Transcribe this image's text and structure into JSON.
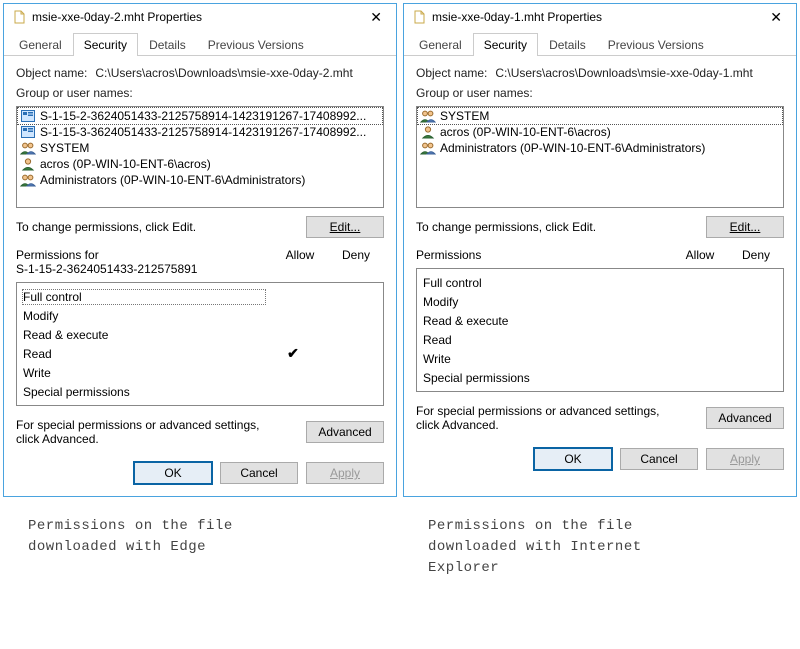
{
  "dialogs": [
    {
      "title": "msie-xxe-0day-2.mht Properties",
      "tabs": [
        "General",
        "Security",
        "Details",
        "Previous Versions"
      ],
      "active_tab": "Security",
      "object_label": "Object name:",
      "object_path": "C:\\Users\\acros\\Downloads\\msie-xxe-0day-2.mht",
      "group_label": "Group or user names:",
      "principals": [
        {
          "icon": "pkg",
          "text": "S-1-15-2-3624051433-2125758914-1423191267-17408992...",
          "selected": true
        },
        {
          "icon": "pkg",
          "text": "S-1-15-3-3624051433-2125758914-1423191267-17408992..."
        },
        {
          "icon": "group",
          "text": "SYSTEM"
        },
        {
          "icon": "user",
          "text": "acros (0P-WIN-10-ENT-6\\acros)"
        },
        {
          "icon": "group",
          "text": "Administrators (0P-WIN-10-ENT-6\\Administrators)"
        }
      ],
      "edit_text": "To change permissions, click Edit.",
      "edit_btn": "Edit...",
      "perm_for_label": "Permissions for\nS-1-15-2-3624051433-212575891",
      "col_allow": "Allow",
      "col_deny": "Deny",
      "permissions": [
        {
          "name": "Full control",
          "allow": "",
          "deny": "",
          "selected": true
        },
        {
          "name": "Modify",
          "allow": "",
          "deny": ""
        },
        {
          "name": "Read & execute",
          "allow": "",
          "deny": ""
        },
        {
          "name": "Read",
          "allow": "✔",
          "deny": ""
        },
        {
          "name": "Write",
          "allow": "",
          "deny": ""
        },
        {
          "name": "Special permissions",
          "allow": "",
          "deny": ""
        }
      ],
      "adv_text": "For special permissions or advanced settings, click Advanced.",
      "adv_btn": "Advanced",
      "ok_btn": "OK",
      "cancel_btn": "Cancel",
      "apply_btn": "Apply"
    },
    {
      "title": "msie-xxe-0day-1.mht Properties",
      "tabs": [
        "General",
        "Security",
        "Details",
        "Previous Versions"
      ],
      "active_tab": "Security",
      "object_label": "Object name:",
      "object_path": "C:\\Users\\acros\\Downloads\\msie-xxe-0day-1.mht",
      "group_label": "Group or user names:",
      "principals": [
        {
          "icon": "group",
          "text": "SYSTEM",
          "selected": true
        },
        {
          "icon": "user",
          "text": "acros (0P-WIN-10-ENT-6\\acros)"
        },
        {
          "icon": "group",
          "text": "Administrators (0P-WIN-10-ENT-6\\Administrators)"
        }
      ],
      "edit_text": "To change permissions, click Edit.",
      "edit_btn": "Edit...",
      "perm_for_label": "Permissions",
      "col_allow": "Allow",
      "col_deny": "Deny",
      "permissions": [
        {
          "name": "Full control",
          "allow": "",
          "deny": ""
        },
        {
          "name": "Modify",
          "allow": "",
          "deny": ""
        },
        {
          "name": "Read & execute",
          "allow": "",
          "deny": ""
        },
        {
          "name": "Read",
          "allow": "",
          "deny": ""
        },
        {
          "name": "Write",
          "allow": "",
          "deny": ""
        },
        {
          "name": "Special permissions",
          "allow": "",
          "deny": ""
        }
      ],
      "adv_text": "For special permissions or advanced settings, click Advanced.",
      "adv_btn": "Advanced",
      "ok_btn": "OK",
      "cancel_btn": "Cancel",
      "apply_btn": "Apply"
    }
  ],
  "captions": [
    "Permissions on the file\ndownloaded with Edge",
    "Permissions on the file\ndownloaded with Internet\nExplorer"
  ]
}
